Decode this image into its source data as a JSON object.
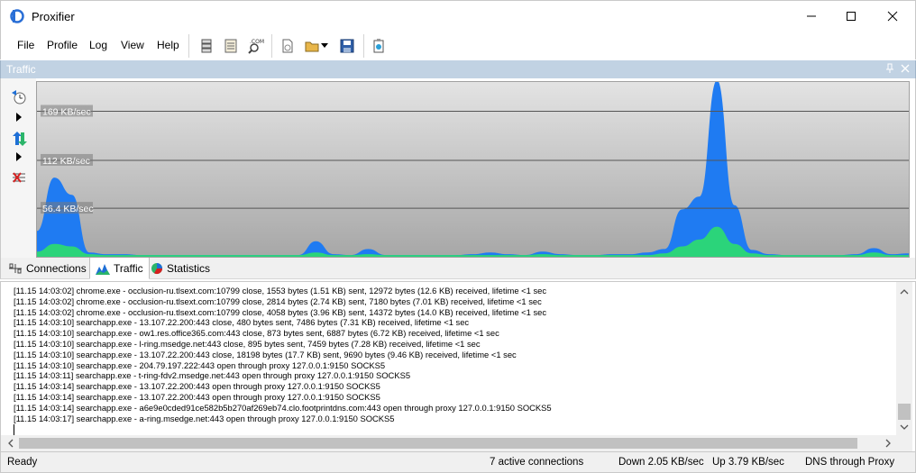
{
  "window": {
    "title": "Proxifier"
  },
  "menu": [
    "File",
    "Profile",
    "Log",
    "View",
    "Help"
  ],
  "toolbar": {
    "icons": [
      "proxy-servers-icon",
      "proxification-rules-icon",
      "name-resolution-icon",
      "new-profile-icon",
      "open-profile-icon",
      "save-profile-icon",
      "advanced-settings-icon"
    ],
    "name_resolution_badge": ".COM"
  },
  "panel": {
    "title": "Traffic"
  },
  "tabs": [
    "Connections",
    "Traffic",
    "Statistics"
  ],
  "active_tab": "Traffic",
  "chart_data": {
    "type": "area",
    "xlabel": "",
    "ylabel": "",
    "y_unit": "KB/sec",
    "gridlines": [
      {
        "value": 56.4,
        "label": "56.4 KB/sec"
      },
      {
        "value": 112,
        "label": "112 KB/sec"
      },
      {
        "value": 169,
        "label": "169 KB/sec"
      }
    ],
    "ylim": [
      0,
      203
    ],
    "x": [
      0,
      2,
      4,
      6,
      8,
      10,
      12,
      14,
      16,
      18,
      20,
      22,
      24,
      26,
      28,
      30,
      32,
      34,
      36,
      38,
      40,
      42,
      44,
      46,
      48,
      50,
      52,
      54,
      56,
      58,
      60,
      62,
      64,
      66,
      68,
      70,
      72,
      74,
      76,
      78,
      80,
      82,
      84,
      86,
      88,
      90,
      92,
      94,
      96,
      98,
      100
    ],
    "series": [
      {
        "values": [
          30,
          92,
          72,
          5,
          3,
          3,
          2,
          2,
          2,
          2,
          2,
          2,
          2,
          2,
          2,
          2,
          18,
          3,
          2,
          9,
          2,
          2,
          2,
          2,
          2,
          3,
          5,
          3,
          2,
          6,
          3,
          2,
          2,
          3,
          3,
          5,
          9,
          55,
          70,
          205,
          60,
          8,
          3,
          2,
          2,
          2,
          2,
          3,
          10,
          3,
          4
        ],
        "color": "#1f7bf2"
      },
      {
        "values": [
          6,
          15,
          12,
          3,
          2,
          2,
          2,
          2,
          2,
          2,
          2,
          2,
          2,
          2,
          2,
          2,
          5,
          2,
          2,
          3,
          2,
          2,
          2,
          2,
          2,
          2,
          2,
          2,
          2,
          3,
          2,
          2,
          2,
          2,
          2,
          2,
          4,
          12,
          20,
          35,
          15,
          4,
          2,
          2,
          2,
          2,
          2,
          2,
          5,
          2,
          2
        ],
        "color": "#2bd47a"
      }
    ]
  },
  "log_lines": [
    "[11.15 14:03:02] chrome.exe - occlusion-ru.tlsext.com:10799 close, 1553 bytes (1.51 KB) sent, 12972 bytes (12.6 KB) received, lifetime <1 sec",
    "[11.15 14:03:02] chrome.exe - occlusion-ru.tlsext.com:10799 close, 2814 bytes (2.74 KB) sent, 7180 bytes (7.01 KB) received, lifetime <1 sec",
    "[11.15 14:03:02] chrome.exe - occlusion-ru.tlsext.com:10799 close, 4058 bytes (3.96 KB) sent, 14372 bytes (14.0 KB) received, lifetime <1 sec",
    "[11.15 14:03:10] searchapp.exe - 13.107.22.200:443 close, 480 bytes sent, 7486 bytes (7.31 KB) received, lifetime <1 sec",
    "[11.15 14:03:10] searchapp.exe - ow1.res.office365.com:443 close, 873 bytes sent, 6887 bytes (6.72 KB) received, lifetime <1 sec",
    "[11.15 14:03:10] searchapp.exe - l-ring.msedge.net:443 close, 895 bytes sent, 7459 bytes (7.28 KB) received, lifetime <1 sec",
    "[11.15 14:03:10] searchapp.exe - 13.107.22.200:443 close, 18198 bytes (17.7 KB) sent, 9690 bytes (9.46 KB) received, lifetime <1 sec",
    "[11.15 14:03:10] searchapp.exe - 204.79.197.222:443 open through proxy 127.0.0.1:9150 SOCKS5",
    "[11.15 14:03:11] searchapp.exe - t-ring-fdv2.msedge.net:443 open through proxy 127.0.0.1:9150 SOCKS5",
    "[11.15 14:03:14] searchapp.exe - 13.107.22.200:443 open through proxy 127.0.0.1:9150 SOCKS5",
    "[11.15 14:03:14] searchapp.exe - 13.107.22.200:443 open through proxy 127.0.0.1:9150 SOCKS5",
    "[11.15 14:03:14] searchapp.exe - a6e9e0cded91ce582b5b270af269eb74.clo.footprintdns.com:443 open through proxy 127.0.0.1:9150 SOCKS5",
    "[11.15 14:03:17] searchapp.exe - a-ring.msedge.net:443 open through proxy 127.0.0.1:9150 SOCKS5"
  ],
  "status": {
    "ready": "Ready",
    "connections": "7 active connections",
    "down": "Down 2.05 KB/sec",
    "up": "Up 3.79 KB/sec",
    "dns": "DNS through Proxy"
  },
  "colors": {
    "panel_header": "#c1d2e3",
    "download": "#1f7bf2",
    "upload": "#2bd47a"
  }
}
